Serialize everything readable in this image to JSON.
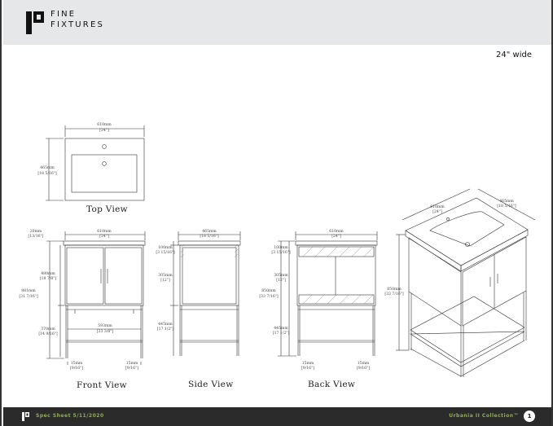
{
  "brand": {
    "line1": "FINE",
    "line2": "FIXTURES"
  },
  "spec": {
    "width_label": "24\" wide"
  },
  "views": {
    "top": "Top View",
    "front": "Front View",
    "side": "Side View",
    "back": "Back View"
  },
  "dims": {
    "top_w_mm": "610mm",
    "top_w_in": "[24\"]",
    "top_d_mm": "465mm",
    "top_d_in": "[18 5/16\"]",
    "front_w_mm": "610mm",
    "front_w_in": "[24\"]",
    "front_t_mm": "20mm",
    "front_t_in": "[13/16\"]",
    "front_door_mm": "480mm",
    "front_door_in": "[18 7/8\"]",
    "front_h_mm": "881mm",
    "front_h_in": "[31 7/16\"]",
    "front_leg_mm": "370mm",
    "front_leg_in": "[14 9/16\"]",
    "front_shelf_mm": "593mm",
    "front_shelf_in": "[23 3/8\"]",
    "front_l_mm": "15mm",
    "front_l_in": "[9/16\"]",
    "front_r_mm": "15mm",
    "front_r_in": "[9/16\"]",
    "side_w_mm": "465mm",
    "side_w_in": "[18 5/16\"]",
    "side_a_mm": "100mm",
    "side_a_in": "[3 15/16\"]",
    "side_b_mm": "305mm",
    "side_b_in": "[12\"]",
    "side_c_mm": "445mm",
    "side_c_in": "[17 1/2\"]",
    "back_w_mm": "610mm",
    "back_w_in": "[24\"]",
    "back_a_mm": "100mm",
    "back_a_in": "[3 15/16\"]",
    "back_b_mm": "305mm",
    "back_b_in": "[12\"]",
    "back_h_mm": "850mm",
    "back_h_in": "[33 7/16\"]",
    "back_c_mm": "445mm",
    "back_c_in": "[17 1/2\"]",
    "back_l_mm": "15mm",
    "back_l_in": "[9/16\"]",
    "back_r_mm": "15mm",
    "back_r_in": "[9/16\"]",
    "iso_w_mm": "610mm",
    "iso_w_in": "[24\"]",
    "iso_d_mm": "465mm",
    "iso_d_in": "[18 5/16\"]",
    "iso_h_mm": "850mm",
    "iso_h_in": "[33 7/16\"]"
  },
  "footer": {
    "left": "Spec Sheet 5/11/2020",
    "right": "Urbania II Collection™",
    "page": "1"
  }
}
